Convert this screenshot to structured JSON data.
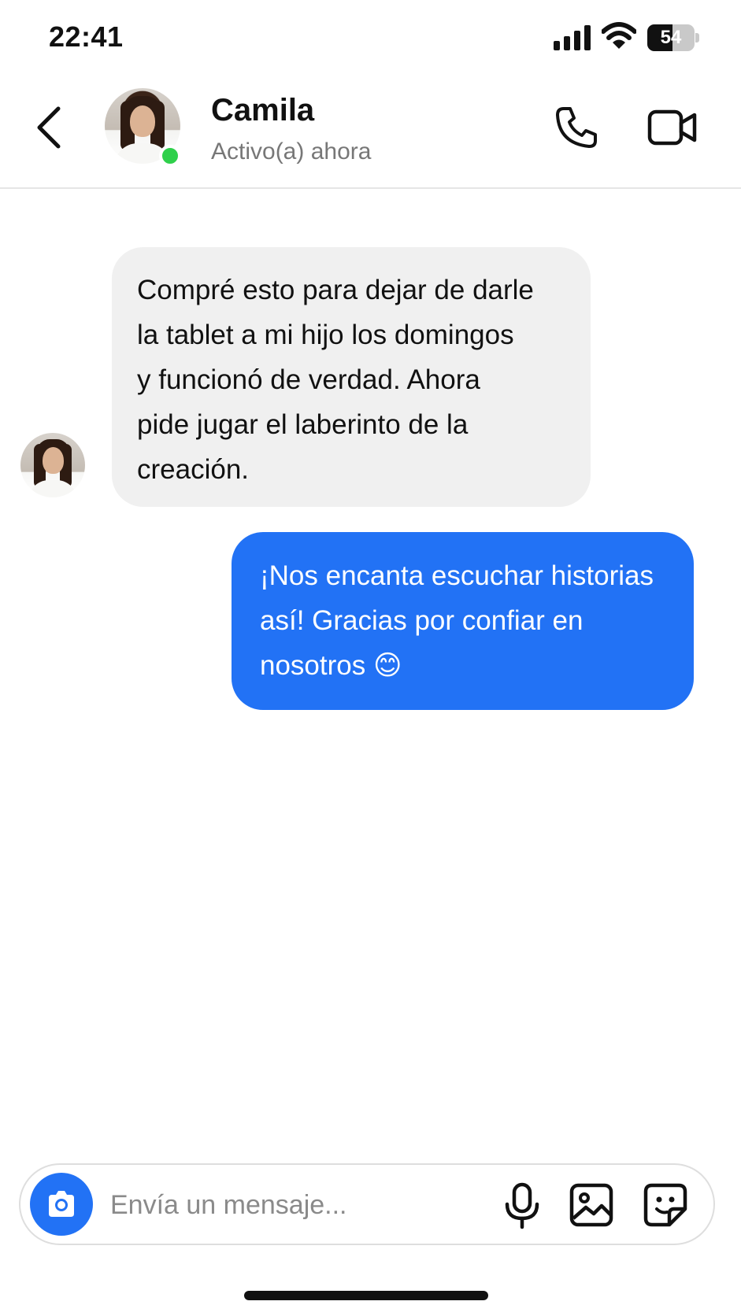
{
  "status_bar": {
    "time": "22:41",
    "battery_level": "54",
    "icons": [
      "signal-icon",
      "wifi-icon",
      "battery-icon"
    ]
  },
  "header": {
    "contact_name": "Camila",
    "contact_status": "Activo(a) ahora",
    "icons": [
      "back-chevron-icon",
      "phone-icon",
      "video-camera-icon"
    ],
    "online": true
  },
  "messages": [
    {
      "direction": "incoming",
      "lines": [
        "Compré esto para dejar de darle",
        "la tablet a mi hijo los domingos",
        "y funcionó de verdad. Ahora",
        "pide jugar el laberinto de la",
        "creación."
      ]
    },
    {
      "direction": "outgoing",
      "lines": [
        "¡Nos encanta escuchar historias",
        "así! Gracias por confiar en",
        "nosotros 😊"
      ]
    }
  ],
  "composer": {
    "placeholder": "Envía un mensaje...",
    "value": "",
    "icons": [
      "camera-icon",
      "microphone-icon",
      "image-icon",
      "sticker-icon"
    ]
  },
  "colors": {
    "accent": "#2272f5",
    "incoming_bubble": "#f0f0f0",
    "online_dot": "#2fd04b",
    "muted_text": "#777777"
  }
}
